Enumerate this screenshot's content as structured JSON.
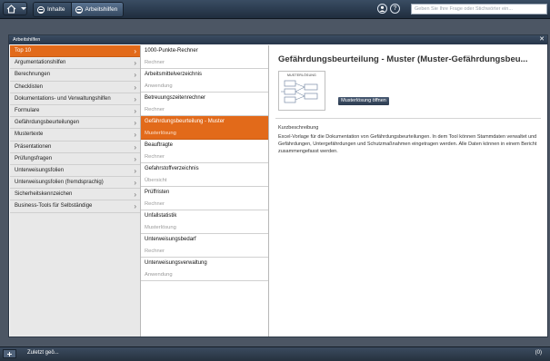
{
  "topbar": {
    "tabs": [
      {
        "label": "Inhalte"
      },
      {
        "label": "Arbeitshilfen"
      }
    ],
    "help_label": "?",
    "search_placeholder": "Geben Sie Ihre Frage oder Stichwörter ein..."
  },
  "window": {
    "title": "Arbeitshilfen",
    "close_label": "✕"
  },
  "categories": [
    "Top 10",
    "Argumentationshilfen",
    "Berechnungen",
    "Checklisten",
    "Dokumentations- und Verwaltungshilfen",
    "Formulare",
    "Gefährdungsbeurteilungen",
    "Mustertexte",
    "Präsentationen",
    "Prüfungsfragen",
    "Unterweisungsfolien",
    "Unterweisungsfolien (fremdsprachig)",
    "Sicherheitskennzeichen",
    "Business-Tools für Selbständige"
  ],
  "items": [
    {
      "name": "1000-Punkte-Rechner",
      "type": "Rechner"
    },
    {
      "name": "Arbeitsmittelverzeichnis",
      "type": "Anwendung"
    },
    {
      "name": "Betreuungszeitenrechner",
      "type": "Rechner"
    },
    {
      "name": "Gefährdungsbeurteilung - Muster",
      "type": "Musterlösung"
    },
    {
      "name": "Beauftragte",
      "type": "Rechner"
    },
    {
      "name": "Gefahrstoffverzeichnis",
      "type": "Übersicht"
    },
    {
      "name": "Prüffristen",
      "type": "Rechner"
    },
    {
      "name": "Unfallstatistik",
      "type": "Musterlösung"
    },
    {
      "name": "Unterweisungsbedarf",
      "type": "Rechner"
    },
    {
      "name": "Unterweisungsverwaltung",
      "type": "Anwendung"
    }
  ],
  "detail": {
    "title": "Gefährdungsbeurteilung - Muster (Muster-Gefährdungsbeu...",
    "thumb_label": "MUSTERLÖSUNG",
    "open_button": "Musterlösung öffnen",
    "desc_heading": "Kurzbeschreibung",
    "description": "Excel-Vorlage für die Dokumentation von Gefährdungsbeurteilungen. In dem Tool können Stammdaten verwaltet und Gefährdungen, Untergefährdungen und Schutzmaßnahmen eingetragen werden. Alle Daten können in einem Bericht zusammengefasst werden."
  },
  "bottombar": {
    "recent_label": "Zuletzt geö...",
    "count": "(0)"
  },
  "colors": {
    "accent": "#e26a1a",
    "chrome": "#2b3a4f"
  }
}
